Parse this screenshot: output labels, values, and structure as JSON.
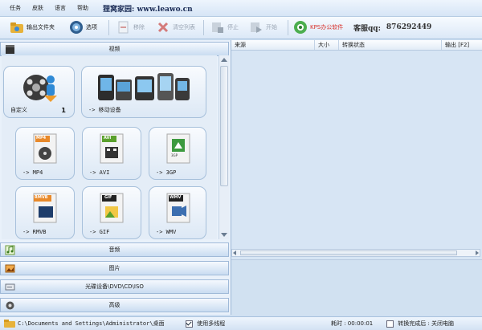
{
  "menu": {
    "items": [
      "任务",
      "皮肤",
      "语言",
      "帮助"
    ],
    "brand": "狸窝家园: www.leawo.cn"
  },
  "toolbar": {
    "output_folder": "输出文件夹",
    "options": "选项",
    "remove": "移除",
    "clear_list": "清空列表",
    "stop": "停止",
    "start": "开始",
    "kps": "KPS办公软件",
    "service_label": "客服qq:",
    "service_qq": "876292449"
  },
  "left": {
    "video_header": "视频",
    "audio_header": "音频",
    "image_header": "图片",
    "disc_header": "光碟设备\\DVD\\CD\\ISO",
    "advanced_header": "高级",
    "tiles": [
      {
        "label": "自定义",
        "count": "1",
        "icon": "custom-film-icon"
      },
      {
        "label": "-> 移动设备",
        "icon": "mobile-devices-icon"
      },
      {
        "label": "-> MP4",
        "badge": "MP4",
        "icon": "mp4-file-icon"
      },
      {
        "label": "-> AVI",
        "badge": "AVI",
        "icon": "avi-file-icon"
      },
      {
        "label": "-> 3GP",
        "badge": "3GP",
        "icon": "3gp-file-icon"
      },
      {
        "label": "-> RMVB",
        "badge": "RMVB",
        "icon": "rmvb-file-icon"
      },
      {
        "label": "-> GIF",
        "badge": "GIF",
        "icon": "gif-file-icon"
      },
      {
        "label": "-> WMV",
        "badge": "WMV",
        "icon": "wmv-file-icon"
      }
    ]
  },
  "table": {
    "columns": [
      "来源",
      "大小",
      "转换状态",
      "输出 [F2]"
    ]
  },
  "status": {
    "path": "C:\\Documents and Settings\\Administrator\\桌面",
    "multithread_label": "使用多线程",
    "multithread_checked": true,
    "elapsed_label": "耗时 : 00:00:01",
    "after_label": "转换完成后 : 关闭电脑",
    "after_checked": false
  },
  "colors": {
    "accent": "#2f6fb5",
    "kps": "#d9322b"
  }
}
